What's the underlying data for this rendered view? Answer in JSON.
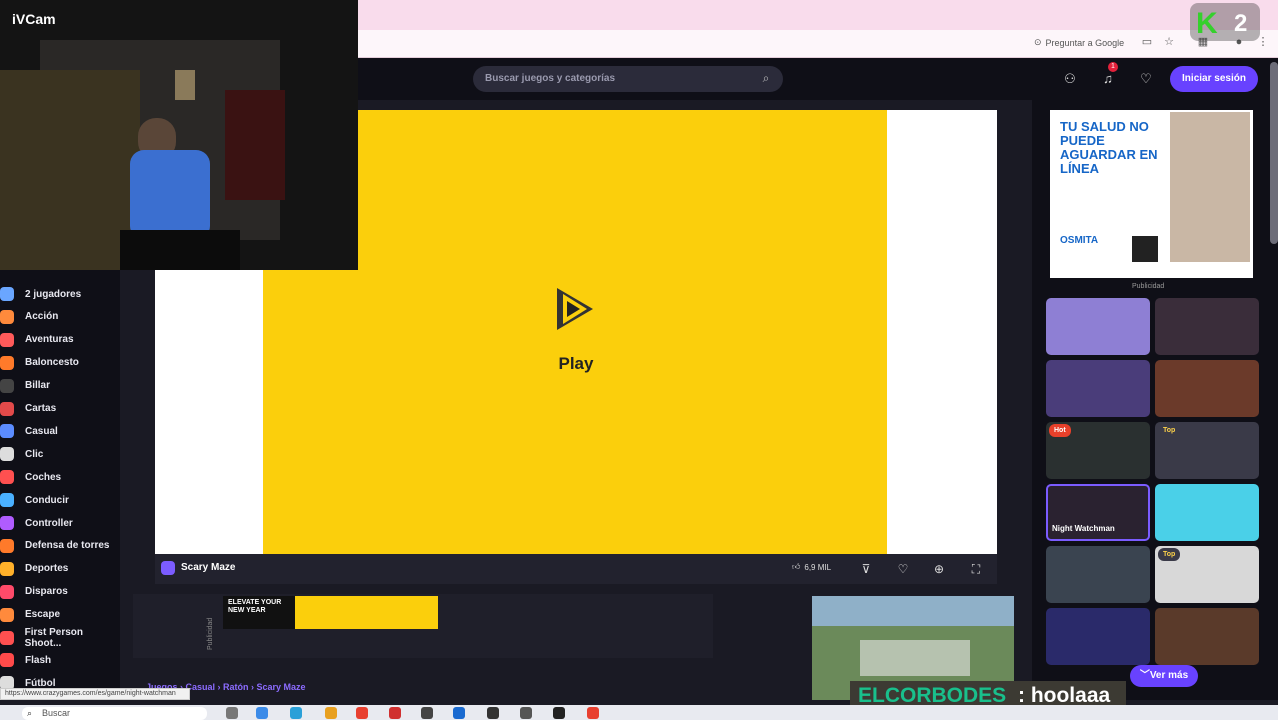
{
  "webcam": {
    "title": "iVCam"
  },
  "browser": {
    "ask_google": "Preguntar a Google",
    "status_url": "https://www.crazygames.com/es/game/night-watchman"
  },
  "overlay": {
    "k2_logo": "K2"
  },
  "header": {
    "search_placeholder": "Buscar juegos y categorías",
    "notification_count": "1",
    "login_label": "Iniciar sesión"
  },
  "sidebar": {
    "items": [
      {
        "label": "2 jugadores",
        "icon": "users-icon",
        "color": "#6aa6ff"
      },
      {
        "label": "Acción",
        "icon": "sword-icon",
        "color": "#ff8a3c"
      },
      {
        "label": "Aventuras",
        "icon": "compass-icon",
        "color": "#ff5a5a"
      },
      {
        "label": "Baloncesto",
        "icon": "basketball-icon",
        "color": "#ff7a2a"
      },
      {
        "label": "Billar",
        "icon": "billiard-icon",
        "color": "#444"
      },
      {
        "label": "Cartas",
        "icon": "cards-icon",
        "color": "#e24a4a"
      },
      {
        "label": "Casual",
        "icon": "casual-icon",
        "color": "#5b8cff"
      },
      {
        "label": "Clic",
        "icon": "cursor-icon",
        "color": "#ddd"
      },
      {
        "label": "Coches",
        "icon": "car-icon",
        "color": "#ff5050"
      },
      {
        "label": "Conducir",
        "icon": "steering-icon",
        "color": "#4ab0ff"
      },
      {
        "label": "Controller",
        "icon": "gamepad-icon",
        "color": "#b05cff"
      },
      {
        "label": "Defensa de torres",
        "icon": "tower-icon",
        "color": "#ff7a2a"
      },
      {
        "label": "Deportes",
        "icon": "sports-icon",
        "color": "#ffb02a"
      },
      {
        "label": "Disparos",
        "icon": "target-icon",
        "color": "#ff4a6a"
      },
      {
        "label": "Escape",
        "icon": "door-icon",
        "color": "#ff8a3c"
      },
      {
        "label": "First Person Shoot...",
        "icon": "crosshair-icon",
        "color": "#ff5050"
      },
      {
        "label": "Flash",
        "icon": "flash-icon",
        "color": "#ff4a4a"
      },
      {
        "label": "Fútbol",
        "icon": "soccer-icon",
        "color": "#ddd"
      }
    ]
  },
  "game": {
    "play_label": "Play",
    "title": "Scary Maze",
    "likes": "6,9 MIL",
    "breadcrumb": "Juegos › Casual › Ratón › Scary Maze"
  },
  "ads": {
    "label": "Publicidad",
    "banner_text": "ELEVATE YOUR NEW YEAR",
    "side_ad_text": "TU SALUD NO PUEDE AGUARDAR EN LÍNEA",
    "side_ad_brand": "OSMITA",
    "side_ad_label": "Publicidad"
  },
  "recommendations": [
    {
      "label": "",
      "badge": "",
      "color": "#8e7fd4"
    },
    {
      "label": "",
      "badge": "",
      "color": "#3a2d3a"
    },
    {
      "label": "",
      "badge": "",
      "color": "#4a3d7a"
    },
    {
      "label": "",
      "badge": "",
      "color": "#6b3a2a"
    },
    {
      "label": "",
      "badge": "Hot",
      "color": "#2a3030"
    },
    {
      "label": "",
      "badge": "Top",
      "color": "#3a3a48"
    },
    {
      "label": "Night Watchman",
      "badge": "",
      "color": "#2a2230"
    },
    {
      "label": "",
      "badge": "",
      "color": "#4ad0e8"
    },
    {
      "label": "",
      "badge": "",
      "color": "#3a4450"
    },
    {
      "label": "",
      "badge": "Top",
      "color": "#d8d8d8"
    },
    {
      "label": "",
      "badge": "",
      "color": "#2a2a6a"
    },
    {
      "label": "",
      "badge": "",
      "color": "#5a3a2a"
    }
  ],
  "ver_mas": "Ver más",
  "chat": {
    "user": "ELCORBODES",
    "message": ": hoolaaa"
  },
  "taskbar": {
    "search": "Buscar"
  }
}
